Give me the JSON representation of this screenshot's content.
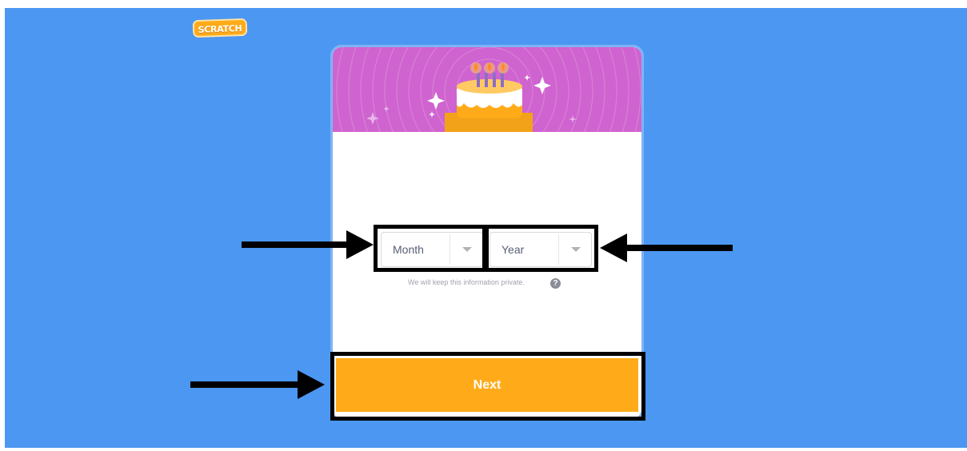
{
  "logo": {
    "text": "SCRATCH"
  },
  "birthday_form": {
    "month_select": {
      "selected": "Month"
    },
    "year_select": {
      "selected": "Year"
    },
    "privacy_note": "We will keep this information private.",
    "help_glyph": "?",
    "next_label": "Next"
  },
  "icons": {
    "banner": "birthday-cake-icon",
    "help": "question-circle-icon",
    "dropdown": "caret-down-icon",
    "annotation": "callout-arrow-icon"
  },
  "colors": {
    "page_background": "#4c97f2",
    "banner": "#cf63cf",
    "next_button": "#ffab19",
    "annotation": "#000000"
  }
}
